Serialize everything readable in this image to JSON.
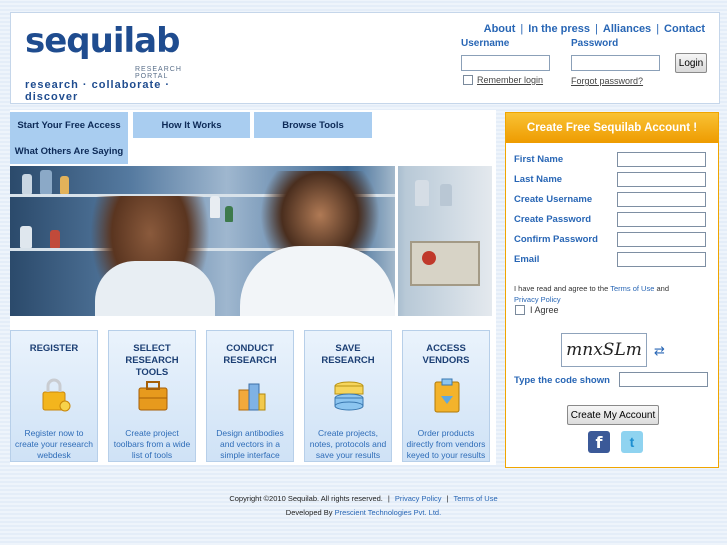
{
  "brand": {
    "name": "sequilab",
    "sub": "RESEARCH PORTAL",
    "tagline": "research · collaborate · discover"
  },
  "topnav": [
    "About",
    "In the press",
    "Alliances",
    "Contact"
  ],
  "login": {
    "username_label": "Username",
    "password_label": "Password",
    "remember": "Remember login",
    "forgot": "Forgot password?",
    "button": "Login"
  },
  "tabs": [
    "Start Your Free Access",
    "How It Works",
    "Browse Tools",
    "What Others Are Saying"
  ],
  "steps": [
    {
      "title": "REGISTER",
      "desc": "Register now to create your research webdesk",
      "icon": "lock-key-icon"
    },
    {
      "title": "SELECT RESEARCH TOOLS",
      "desc": "Create project toolbars from a wide list of tools",
      "icon": "toolbox-icon"
    },
    {
      "title": "CONDUCT RESEARCH",
      "desc": "Design antibodies and vectors in a simple interface",
      "icon": "cubes-icon"
    },
    {
      "title": "SAVE RESEARCH",
      "desc": "Create projects, notes, protocols and save your results",
      "icon": "database-icon"
    },
    {
      "title": "ACCESS VENDORS",
      "desc": "Order products directly from vendors keyed to your results",
      "icon": "clipboard-icon"
    }
  ],
  "signup": {
    "title": "Create Free Sequilab Account !",
    "fields": [
      "First Name",
      "Last Name",
      "Create Username",
      "Create Password",
      "Confirm Password",
      "Email"
    ],
    "agree_prefix": "I have read and agree to the",
    "terms": "Terms of Use",
    "and": "and",
    "privacy": "Privacy Policy",
    "agree_label": "I Agree",
    "captcha": "mnxSLm",
    "code_label": "Type the code shown",
    "button": "Create My Account"
  },
  "footer": {
    "copyright": "Copyright ©2010 Sequilab. All rights reserved.",
    "privacy": "Privacy Policy",
    "terms": "Terms of Use",
    "dev_prefix": "Developed By",
    "dev": "Prescient Technologies Pvt. Ltd."
  }
}
